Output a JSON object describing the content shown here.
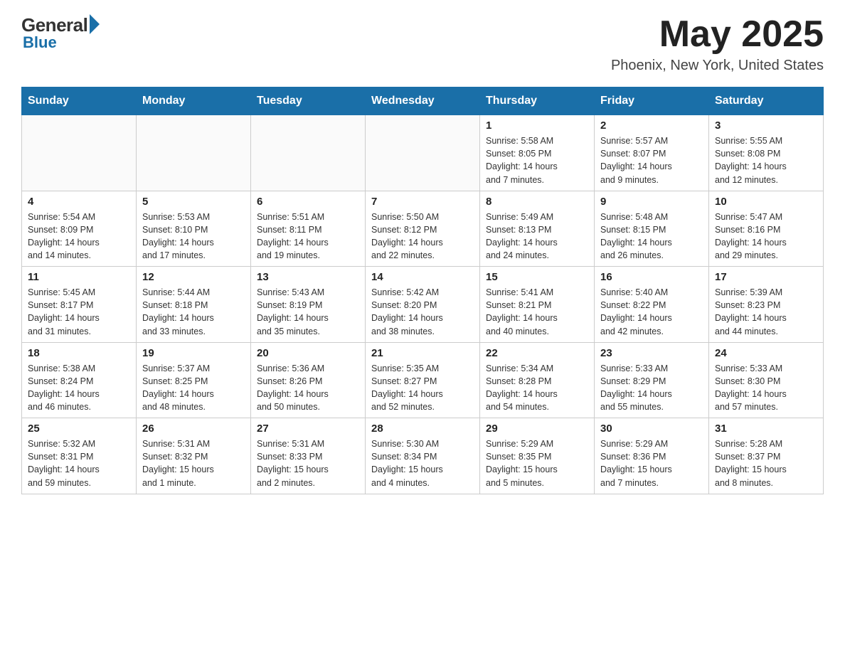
{
  "header": {
    "logo_general": "General",
    "logo_blue": "Blue",
    "month": "May 2025",
    "location": "Phoenix, New York, United States"
  },
  "days_of_week": [
    "Sunday",
    "Monday",
    "Tuesday",
    "Wednesday",
    "Thursday",
    "Friday",
    "Saturday"
  ],
  "weeks": [
    [
      {
        "day": "",
        "info": ""
      },
      {
        "day": "",
        "info": ""
      },
      {
        "day": "",
        "info": ""
      },
      {
        "day": "",
        "info": ""
      },
      {
        "day": "1",
        "info": "Sunrise: 5:58 AM\nSunset: 8:05 PM\nDaylight: 14 hours\nand 7 minutes."
      },
      {
        "day": "2",
        "info": "Sunrise: 5:57 AM\nSunset: 8:07 PM\nDaylight: 14 hours\nand 9 minutes."
      },
      {
        "day": "3",
        "info": "Sunrise: 5:55 AM\nSunset: 8:08 PM\nDaylight: 14 hours\nand 12 minutes."
      }
    ],
    [
      {
        "day": "4",
        "info": "Sunrise: 5:54 AM\nSunset: 8:09 PM\nDaylight: 14 hours\nand 14 minutes."
      },
      {
        "day": "5",
        "info": "Sunrise: 5:53 AM\nSunset: 8:10 PM\nDaylight: 14 hours\nand 17 minutes."
      },
      {
        "day": "6",
        "info": "Sunrise: 5:51 AM\nSunset: 8:11 PM\nDaylight: 14 hours\nand 19 minutes."
      },
      {
        "day": "7",
        "info": "Sunrise: 5:50 AM\nSunset: 8:12 PM\nDaylight: 14 hours\nand 22 minutes."
      },
      {
        "day": "8",
        "info": "Sunrise: 5:49 AM\nSunset: 8:13 PM\nDaylight: 14 hours\nand 24 minutes."
      },
      {
        "day": "9",
        "info": "Sunrise: 5:48 AM\nSunset: 8:15 PM\nDaylight: 14 hours\nand 26 minutes."
      },
      {
        "day": "10",
        "info": "Sunrise: 5:47 AM\nSunset: 8:16 PM\nDaylight: 14 hours\nand 29 minutes."
      }
    ],
    [
      {
        "day": "11",
        "info": "Sunrise: 5:45 AM\nSunset: 8:17 PM\nDaylight: 14 hours\nand 31 minutes."
      },
      {
        "day": "12",
        "info": "Sunrise: 5:44 AM\nSunset: 8:18 PM\nDaylight: 14 hours\nand 33 minutes."
      },
      {
        "day": "13",
        "info": "Sunrise: 5:43 AM\nSunset: 8:19 PM\nDaylight: 14 hours\nand 35 minutes."
      },
      {
        "day": "14",
        "info": "Sunrise: 5:42 AM\nSunset: 8:20 PM\nDaylight: 14 hours\nand 38 minutes."
      },
      {
        "day": "15",
        "info": "Sunrise: 5:41 AM\nSunset: 8:21 PM\nDaylight: 14 hours\nand 40 minutes."
      },
      {
        "day": "16",
        "info": "Sunrise: 5:40 AM\nSunset: 8:22 PM\nDaylight: 14 hours\nand 42 minutes."
      },
      {
        "day": "17",
        "info": "Sunrise: 5:39 AM\nSunset: 8:23 PM\nDaylight: 14 hours\nand 44 minutes."
      }
    ],
    [
      {
        "day": "18",
        "info": "Sunrise: 5:38 AM\nSunset: 8:24 PM\nDaylight: 14 hours\nand 46 minutes."
      },
      {
        "day": "19",
        "info": "Sunrise: 5:37 AM\nSunset: 8:25 PM\nDaylight: 14 hours\nand 48 minutes."
      },
      {
        "day": "20",
        "info": "Sunrise: 5:36 AM\nSunset: 8:26 PM\nDaylight: 14 hours\nand 50 minutes."
      },
      {
        "day": "21",
        "info": "Sunrise: 5:35 AM\nSunset: 8:27 PM\nDaylight: 14 hours\nand 52 minutes."
      },
      {
        "day": "22",
        "info": "Sunrise: 5:34 AM\nSunset: 8:28 PM\nDaylight: 14 hours\nand 54 minutes."
      },
      {
        "day": "23",
        "info": "Sunrise: 5:33 AM\nSunset: 8:29 PM\nDaylight: 14 hours\nand 55 minutes."
      },
      {
        "day": "24",
        "info": "Sunrise: 5:33 AM\nSunset: 8:30 PM\nDaylight: 14 hours\nand 57 minutes."
      }
    ],
    [
      {
        "day": "25",
        "info": "Sunrise: 5:32 AM\nSunset: 8:31 PM\nDaylight: 14 hours\nand 59 minutes."
      },
      {
        "day": "26",
        "info": "Sunrise: 5:31 AM\nSunset: 8:32 PM\nDaylight: 15 hours\nand 1 minute."
      },
      {
        "day": "27",
        "info": "Sunrise: 5:31 AM\nSunset: 8:33 PM\nDaylight: 15 hours\nand 2 minutes."
      },
      {
        "day": "28",
        "info": "Sunrise: 5:30 AM\nSunset: 8:34 PM\nDaylight: 15 hours\nand 4 minutes."
      },
      {
        "day": "29",
        "info": "Sunrise: 5:29 AM\nSunset: 8:35 PM\nDaylight: 15 hours\nand 5 minutes."
      },
      {
        "day": "30",
        "info": "Sunrise: 5:29 AM\nSunset: 8:36 PM\nDaylight: 15 hours\nand 7 minutes."
      },
      {
        "day": "31",
        "info": "Sunrise: 5:28 AM\nSunset: 8:37 PM\nDaylight: 15 hours\nand 8 minutes."
      }
    ]
  ]
}
